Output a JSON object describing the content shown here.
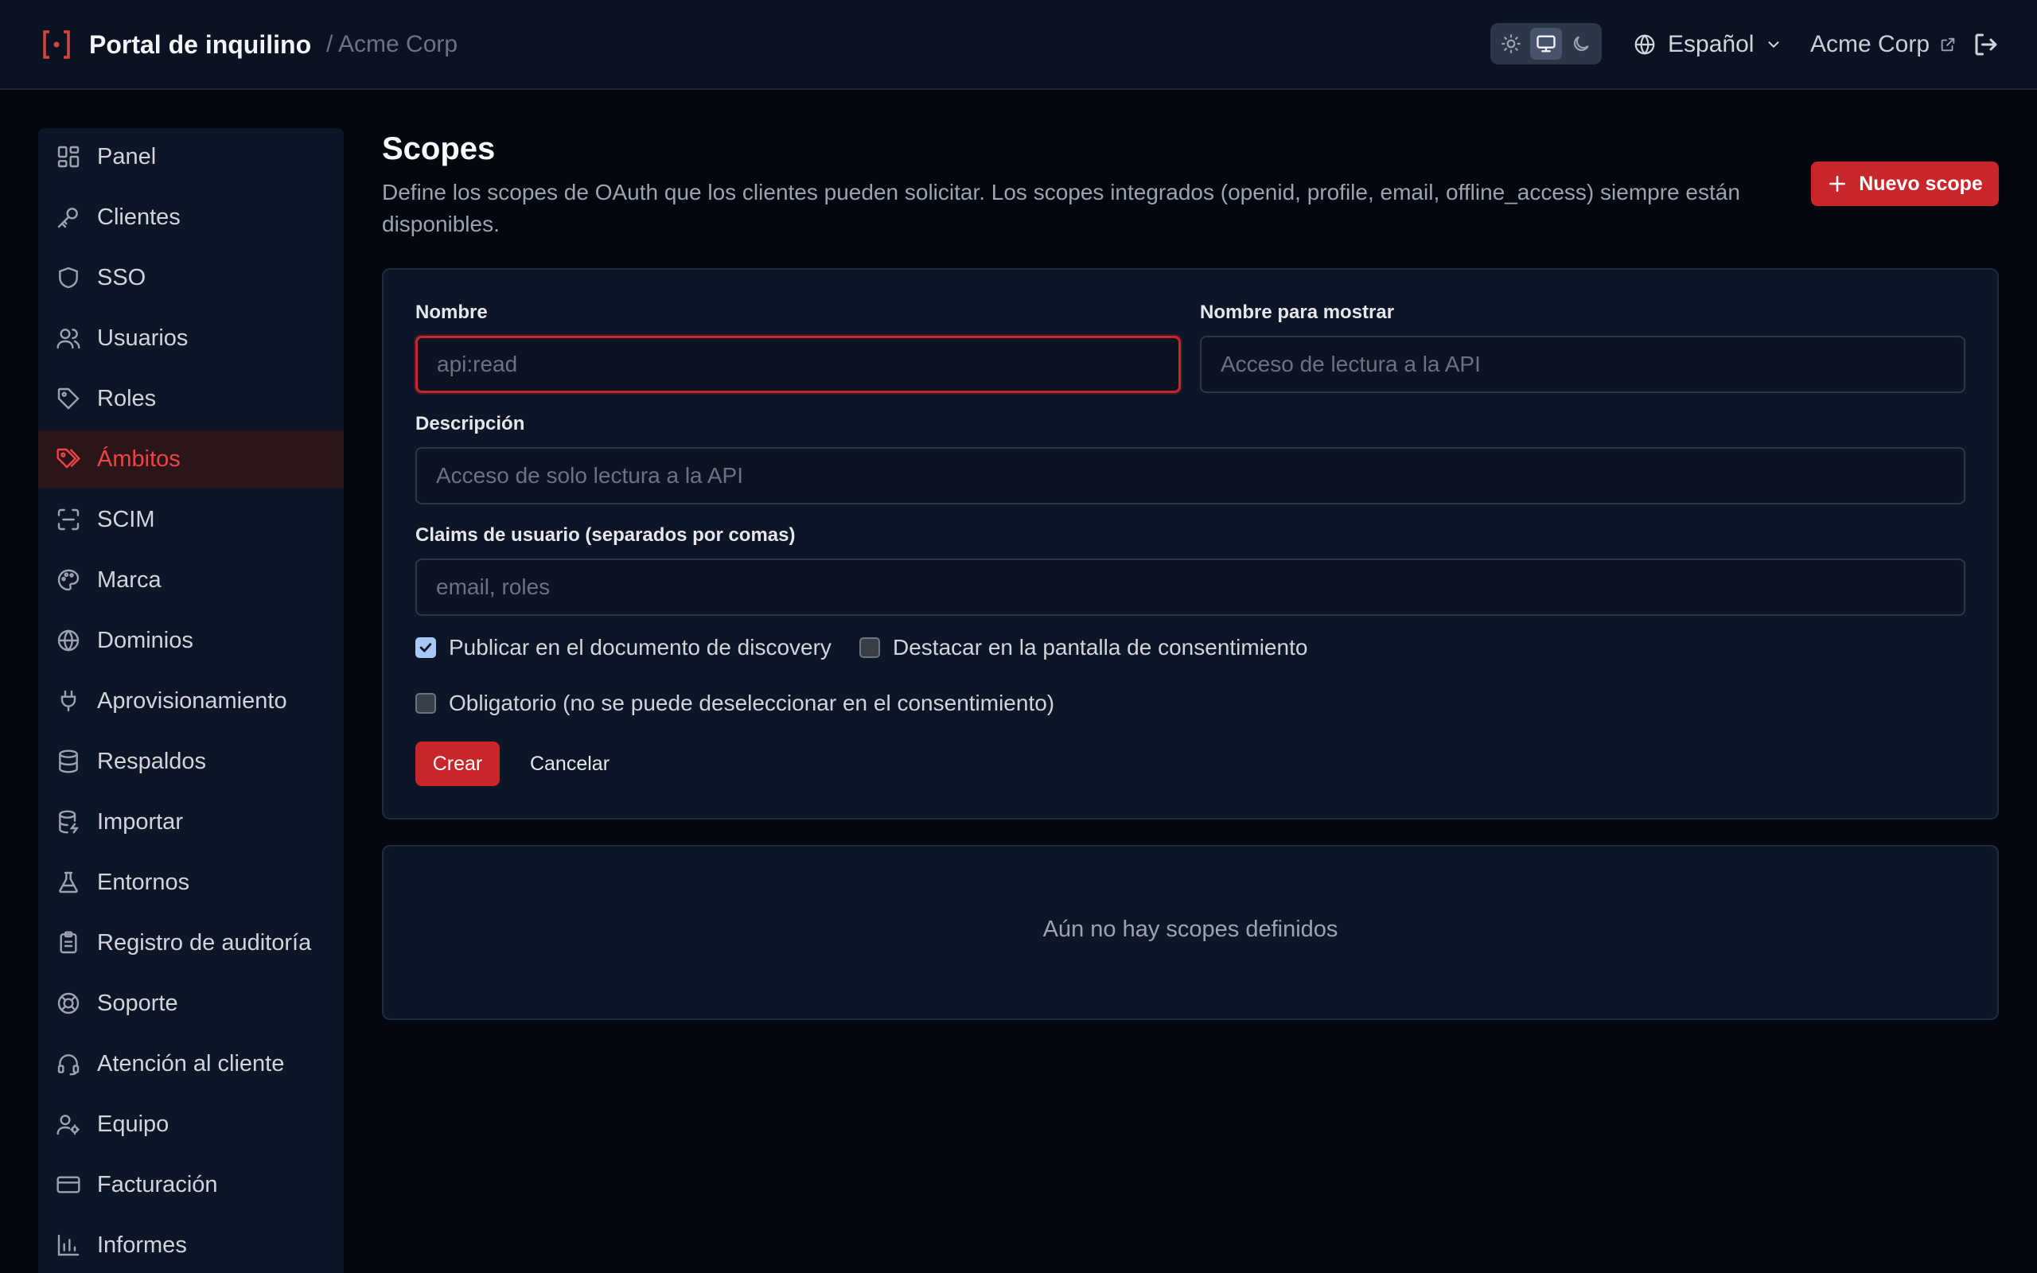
{
  "header": {
    "title": "Portal de inquilino",
    "breadcrumb": "/ Acme Corp",
    "language": "Español",
    "tenant_link": "Acme Corp"
  },
  "sidebar": {
    "items": [
      {
        "label": "Panel",
        "icon": "dashboard-icon"
      },
      {
        "label": "Clientes",
        "icon": "key-icon"
      },
      {
        "label": "SSO",
        "icon": "shield-icon"
      },
      {
        "label": "Usuarios",
        "icon": "users-icon"
      },
      {
        "label": "Roles",
        "icon": "tag-icon"
      },
      {
        "label": "Ámbitos",
        "icon": "tags-icon",
        "active": true
      },
      {
        "label": "SCIM",
        "icon": "scan-icon"
      },
      {
        "label": "Marca",
        "icon": "palette-icon"
      },
      {
        "label": "Dominios",
        "icon": "globe-icon"
      },
      {
        "label": "Aprovisionamiento",
        "icon": "plug-icon"
      },
      {
        "label": "Respaldos",
        "icon": "database-icon"
      },
      {
        "label": "Importar",
        "icon": "database-import-icon"
      },
      {
        "label": "Entornos",
        "icon": "flask-icon"
      },
      {
        "label": "Registro de auditoría",
        "icon": "clipboard-icon"
      },
      {
        "label": "Soporte",
        "icon": "lifebuoy-icon"
      },
      {
        "label": "Atención al cliente",
        "icon": "headset-icon"
      },
      {
        "label": "Equipo",
        "icon": "user-cog-icon"
      },
      {
        "label": "Facturación",
        "icon": "credit-card-icon"
      },
      {
        "label": "Informes",
        "icon": "bar-chart-icon"
      }
    ]
  },
  "main": {
    "title": "Scopes",
    "description": "Define los scopes de OAuth que los clientes pueden solicitar. Los scopes integrados (openid, profile, email, offline_access) siempre están disponibles.",
    "new_button": "Nuevo scope",
    "form": {
      "name_label": "Nombre",
      "name_placeholder": "api:read",
      "display_label": "Nombre para mostrar",
      "display_placeholder": "Acceso de lectura a la API",
      "desc_label": "Descripción",
      "desc_placeholder": "Acceso de solo lectura a la API",
      "claims_label": "Claims de usuario (separados por comas)",
      "claims_placeholder": "email, roles",
      "check_discovery": "Publicar en el documento de discovery",
      "check_consent": "Destacar en la pantalla de consentimiento",
      "check_required": "Obligatorio (no se puede deseleccionar en el consentimiento)",
      "create": "Crear",
      "cancel": "Cancelar"
    },
    "empty": "Aún no hay scopes definidos"
  },
  "colors": {
    "accent": "#c8262a",
    "checkbox_checked": "#a8c7fa"
  }
}
